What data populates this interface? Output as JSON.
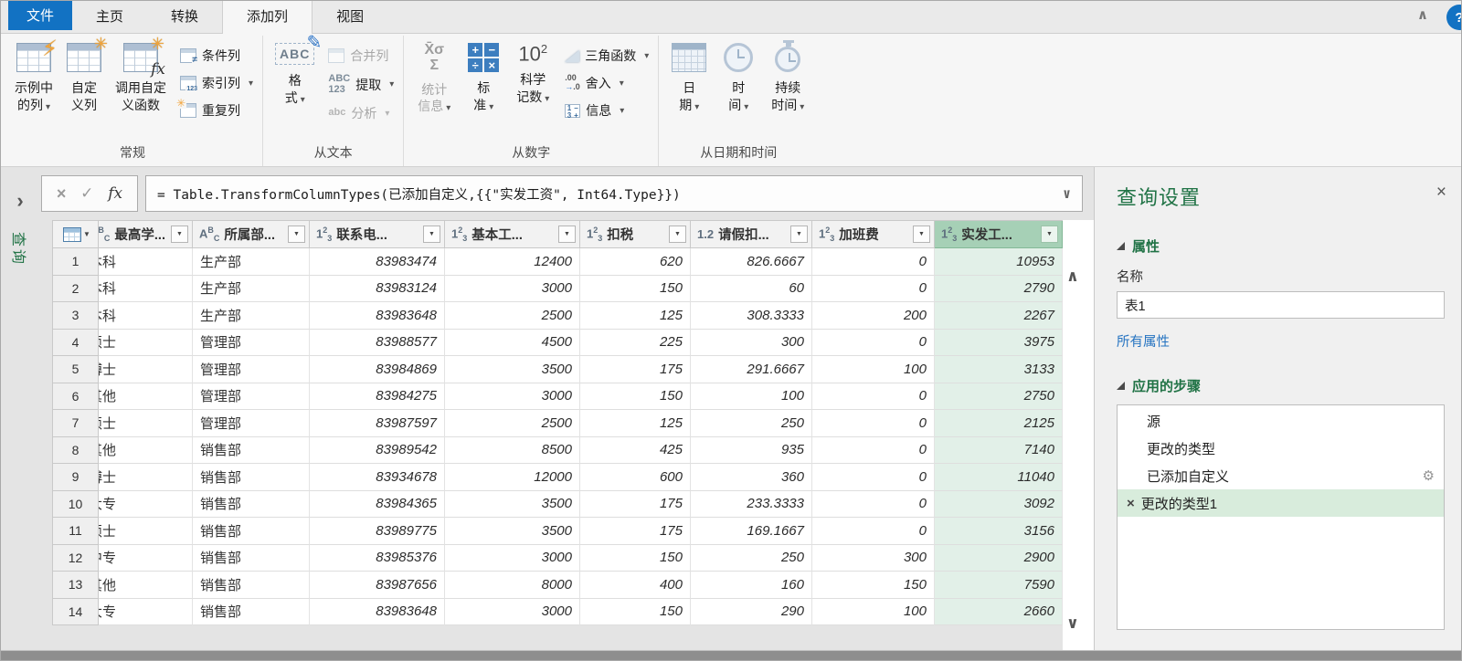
{
  "icons": {
    "help": "?",
    "ribbon_collapse": "∧",
    "pane_expand": "›",
    "formula_cancel": "×",
    "formula_check": "✓",
    "formula_fx": "fx",
    "formula_expand": "∨",
    "panel_close": "×",
    "scroll_up": "∧",
    "scroll_down": "∨",
    "step_delete": "×",
    "step_gear": "⚙",
    "lightning": "⚡",
    "star": "✳",
    "fx_overlay": "fx",
    "pencil": "✎",
    "not_equal": "≠",
    "index_123": "123",
    "abc_text": "ABC",
    "extract_top": "ABC",
    "extract_bottom": "123",
    "parse_text": "abc",
    "xbar_sigma": "X̄σ",
    "sigma": "Σ",
    "sci_base": "10",
    "sci_exp": "2",
    "std_plus": "+",
    "std_minus": "−",
    "std_div": "÷",
    "std_mul": "×",
    "round_top": ".00",
    "round_arrow": "→",
    "round_bottom": ".0",
    "info_1": "1",
    "info_minus": "−",
    "info_3": "3",
    "info_plus": "+",
    "filter_arrow": "▼",
    "corner_dd": "▼"
  },
  "tabs": {
    "file": "文件",
    "home": "主页",
    "transform": "转换",
    "add_column": "添加列",
    "view": "视图"
  },
  "ribbon": {
    "groups": {
      "general": {
        "label": "常规",
        "column_from_examples": "示例中\n的列",
        "custom_column": "自定\n义列",
        "invoke_custom_function": "调用自定\n义函数",
        "conditional_column": "条件列",
        "index_column": "索引列",
        "duplicate_column": "重复列"
      },
      "from_text": {
        "label": "从文本",
        "format": "格\n式",
        "merge_columns": "合并列",
        "extract": "提取",
        "parse": "分析"
      },
      "from_number": {
        "label": "从数字",
        "statistics": "统计\n信息",
        "standard": "标\n准",
        "scientific": "科学\n记数",
        "trigonometry": "三角函数",
        "rounding": "舍入",
        "information": "信息"
      },
      "from_datetime": {
        "label": "从日期和时间",
        "date": "日\n期",
        "time": "时\n间",
        "duration": "持续\n时间"
      }
    }
  },
  "formula_bar": {
    "text": "= Table.TransformColumnTypes(已添加自定义,{{\"实发工资\", Int64.Type}})"
  },
  "queries_pane": {
    "label": "查询"
  },
  "grid": {
    "columns": [
      {
        "icon": "text",
        "label": "最高学...",
        "clipped": true
      },
      {
        "icon": "text",
        "label": "所属部..."
      },
      {
        "icon": "int",
        "label": "联系电..."
      },
      {
        "icon": "int",
        "label": "基本工..."
      },
      {
        "icon": "int",
        "label": "扣税"
      },
      {
        "icon": "dec",
        "label": "请假扣..."
      },
      {
        "icon": "int",
        "label": "加班费"
      },
      {
        "icon": "int",
        "label": "实发工...",
        "selected": true
      }
    ],
    "rows": [
      {
        "n": "1",
        "cells": [
          "本科",
          "生产部",
          "83983474",
          "12400",
          "620",
          "826.6667",
          "0",
          "10953"
        ]
      },
      {
        "n": "2",
        "cells": [
          "本科",
          "生产部",
          "83983124",
          "3000",
          "150",
          "60",
          "0",
          "2790"
        ]
      },
      {
        "n": "3",
        "cells": [
          "本科",
          "生产部",
          "83983648",
          "2500",
          "125",
          "308.3333",
          "200",
          "2267"
        ]
      },
      {
        "n": "4",
        "cells": [
          "硕士",
          "管理部",
          "83988577",
          "4500",
          "225",
          "300",
          "0",
          "3975"
        ]
      },
      {
        "n": "5",
        "cells": [
          "博士",
          "管理部",
          "83984869",
          "3500",
          "175",
          "291.6667",
          "100",
          "3133"
        ]
      },
      {
        "n": "6",
        "cells": [
          "其他",
          "管理部",
          "83984275",
          "3000",
          "150",
          "100",
          "0",
          "2750"
        ]
      },
      {
        "n": "7",
        "cells": [
          "硕士",
          "管理部",
          "83987597",
          "2500",
          "125",
          "250",
          "0",
          "2125"
        ]
      },
      {
        "n": "8",
        "cells": [
          "其他",
          "销售部",
          "83989542",
          "8500",
          "425",
          "935",
          "0",
          "7140"
        ]
      },
      {
        "n": "9",
        "cells": [
          "博士",
          "销售部",
          "83934678",
          "12000",
          "600",
          "360",
          "0",
          "11040"
        ]
      },
      {
        "n": "10",
        "cells": [
          "大专",
          "销售部",
          "83984365",
          "3500",
          "175",
          "233.3333",
          "0",
          "3092"
        ]
      },
      {
        "n": "11",
        "cells": [
          "硕士",
          "销售部",
          "83989775",
          "3500",
          "175",
          "169.1667",
          "0",
          "3156"
        ]
      },
      {
        "n": "12",
        "cells": [
          "中专",
          "销售部",
          "83985376",
          "3000",
          "150",
          "250",
          "300",
          "2900"
        ]
      },
      {
        "n": "13",
        "cells": [
          "其他",
          "销售部",
          "83987656",
          "8000",
          "400",
          "160",
          "150",
          "7590"
        ]
      },
      {
        "n": "14",
        "cells": [
          "大专",
          "销售部",
          "83983648",
          "3000",
          "150",
          "290",
          "100",
          "2660"
        ]
      }
    ]
  },
  "settings": {
    "title": "查询设置",
    "properties_header": "属性",
    "name_label": "名称",
    "name_value": "表1",
    "all_properties": "所有属性",
    "steps_header": "应用的步骤",
    "steps": [
      {
        "label": "源"
      },
      {
        "label": "更改的类型"
      },
      {
        "label": "已添加自定义",
        "gear": true
      },
      {
        "label": "更改的类型1",
        "selected": true
      }
    ]
  }
}
